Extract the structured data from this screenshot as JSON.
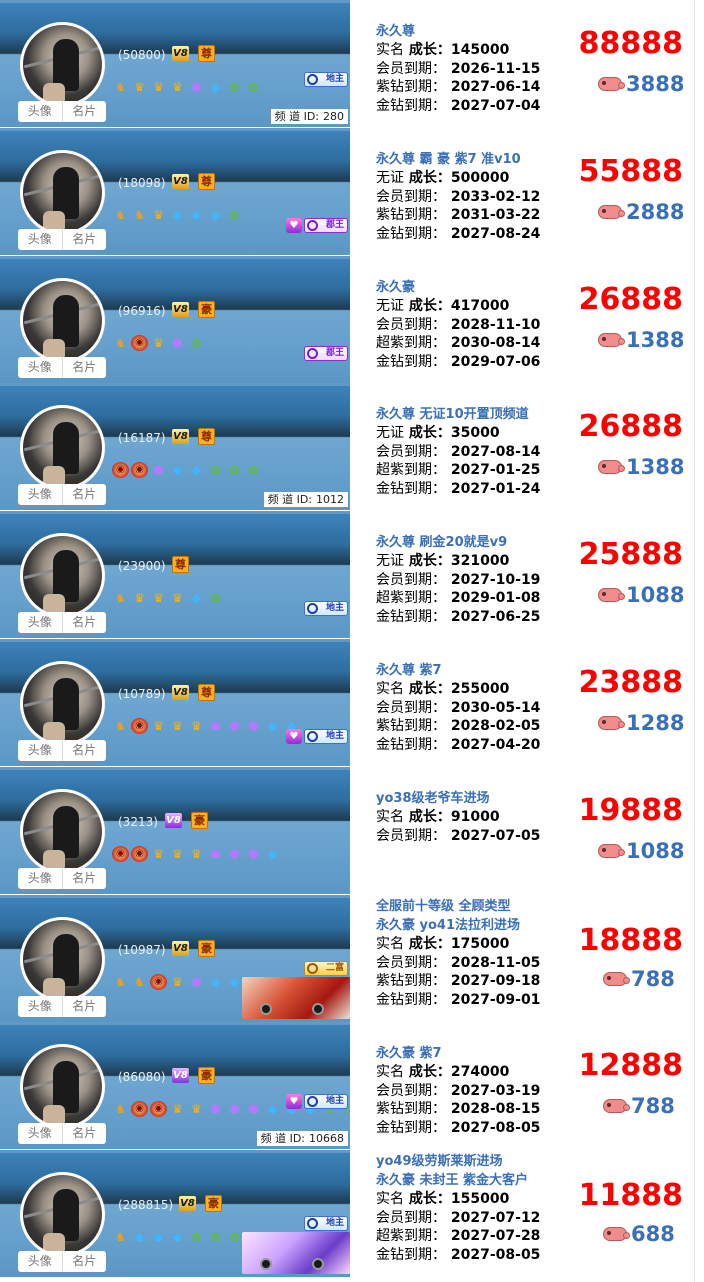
{
  "avatar_tabs": {
    "avatar": "头像",
    "card": "名片"
  },
  "channel_label": "频 道 ID:",
  "cards": [
    {
      "uid": "(50800)",
      "vip": "V8",
      "vip_color": "gold",
      "noble": "尊",
      "icons": [
        "eagle-icon",
        "crown-icon",
        "crown-icon",
        "crown-icon",
        "gem-icon",
        "diamond-icon",
        "leaf-icon",
        "leaf-icon"
      ],
      "lord": "地主",
      "lord_style": "blue",
      "gift": false,
      "channel_id": "280",
      "car": "",
      "headline": [
        "永久尊"
      ],
      "lines": [
        [
          "实名",
          "成长：145000"
        ],
        [
          "会员到期：",
          "2026-11-15"
        ],
        [
          "紫钻到期：",
          "2027-06-14"
        ],
        [
          "金钻到期：",
          "2027-07-04"
        ]
      ],
      "price": "88888",
      "sub": "3888"
    },
    {
      "uid": "(18098)",
      "vip": "V8",
      "vip_color": "gold",
      "noble": "尊",
      "icons": [
        "eagle-icon",
        "eagle-icon",
        "crown-icon",
        "diamond-icon",
        "diamond-icon",
        "diamond-icon",
        "leaf-icon"
      ],
      "lord": "郡王",
      "lord_style": "purple",
      "gift": true,
      "gift_style": "purple",
      "channel_id": "",
      "car": "",
      "headline": [
        "永久尊 霸 豪 紫7 准v10"
      ],
      "lines": [
        [
          "无证",
          "成长：500000"
        ],
        [
          "会员到期：",
          "2033-02-12"
        ],
        [
          "紫钻到期：",
          "2031-03-22"
        ],
        [
          "金钻到期：",
          "2027-08-24"
        ]
      ],
      "price": "55888",
      "sub": "2888"
    },
    {
      "uid": "(96916)",
      "vip": "V8",
      "vip_color": "gold",
      "noble": "豪",
      "icons": [
        "eagle-icon",
        "lion-icon",
        "crown-icon",
        "gem-icon",
        "leaf-icon"
      ],
      "lord": "郡王",
      "lord_style": "purple",
      "gift": false,
      "channel_id": "",
      "car": "",
      "headline": [
        "永久豪"
      ],
      "lines": [
        [
          "无证",
          "成长：417000"
        ],
        [
          "会员到期：",
          "2028-11-10"
        ],
        [
          "超紫到期：",
          "2030-08-14"
        ],
        [
          "金钻到期：",
          "2029-07-06"
        ]
      ],
      "price": "26888",
      "sub": "1388"
    },
    {
      "uid": "(16187)",
      "vip": "V8",
      "vip_color": "gold",
      "noble": "尊",
      "icons": [
        "lion-icon",
        "lion-icon",
        "gem-icon",
        "diamond-icon",
        "diamond-icon",
        "leaf-icon",
        "leaf-icon",
        "leaf-icon"
      ],
      "lord": "",
      "lord_style": "blue",
      "gift": false,
      "channel_id": "1012",
      "car": "",
      "headline": [
        "永久尊 无证10开置顶频道"
      ],
      "lines": [
        [
          "无证",
          "成长：35000"
        ],
        [
          "会员到期：",
          "2027-08-14"
        ],
        [
          "超紫到期：",
          "2027-01-25"
        ],
        [
          "金钻到期：",
          "2027-01-24"
        ]
      ],
      "price": "26888",
      "sub": "1388"
    },
    {
      "uid": "(23900)",
      "vip": "",
      "vip_color": "gold",
      "noble": "尊",
      "icons": [
        "eagle-icon",
        "crown-icon",
        "crown-icon",
        "crown-icon",
        "diamond-icon",
        "leaf-icon"
      ],
      "lord": "地主",
      "lord_style": "blue",
      "gift": false,
      "channel_id": "",
      "car": "",
      "headline": [
        "永久尊  刷金20就是v9"
      ],
      "lines": [
        [
          "无证",
          "成长：321000"
        ],
        [
          "会员到期：",
          "2027-10-19"
        ],
        [
          "超紫到期：",
          "2029-01-08"
        ],
        [
          "金钻到期：",
          "2027-06-25"
        ]
      ],
      "price": "25888",
      "sub": "1088"
    },
    {
      "uid": "(10789)",
      "vip": "V8",
      "vip_color": "gold",
      "noble": "尊",
      "icons": [
        "eagle-icon",
        "lion-icon",
        "crown-icon",
        "crown-icon",
        "crown-icon",
        "gem-icon",
        "gem-icon",
        "gem-icon",
        "diamond-icon",
        "diamond-icon"
      ],
      "lord": "地主",
      "lord_style": "blue",
      "gift": true,
      "gift_style": "purple",
      "channel_id": "",
      "car": "",
      "headline": [
        "永久尊  紫7"
      ],
      "lines": [
        [
          "实名",
          "成长：255000"
        ],
        [
          "会员到期：",
          "2030-05-14"
        ],
        [
          "紫钻到期：",
          "2028-02-05"
        ],
        [
          "金钻到期：",
          "2027-04-20"
        ]
      ],
      "price": "23888",
      "sub": "1288"
    },
    {
      "uid": "(3213)",
      "vip": "V8",
      "vip_color": "purple",
      "noble": "豪",
      "icons": [
        "lion-icon",
        "lion-icon",
        "crown-icon",
        "crown-icon",
        "crown-icon",
        "gem-icon",
        "gem-icon",
        "gem-icon",
        "diamond-icon"
      ],
      "lord": "",
      "lord_style": "blue",
      "gift": false,
      "channel_id": "",
      "car": "",
      "headline": [
        "yo38级老爷车进场"
      ],
      "lines": [
        [
          "实名",
          "成长：91000"
        ],
        [
          "会员到期：",
          "2027-07-05"
        ]
      ],
      "price": "19888",
      "sub": "1088"
    },
    {
      "uid": "(10987)",
      "vip": "V8",
      "vip_color": "gold",
      "noble": "豪",
      "icons": [
        "eagle-icon",
        "eagle-icon",
        "lion-icon",
        "crown-icon",
        "gem-icon",
        "diamond-icon",
        "diamond-icon"
      ],
      "lord": "二富",
      "lord_style": "gold",
      "gift": false,
      "channel_id": "",
      "car": "red",
      "headline": [
        "全服前十等级 全顾类型",
        "永久豪 yo41法拉利进场"
      ],
      "lines": [
        [
          "实名",
          "成长：175000"
        ],
        [
          "会员到期：",
          "2028-11-05"
        ],
        [
          "紫钻到期：",
          "2027-09-18"
        ],
        [
          "金钻到期：",
          "2027-09-01"
        ]
      ],
      "price": "18888",
      "sub": "788"
    },
    {
      "uid": "(86080)",
      "vip": "V8",
      "vip_color": "purple",
      "noble": "豪",
      "icons": [
        "eagle-icon",
        "lion-icon",
        "lion-icon",
        "crown-icon",
        "crown-icon",
        "gem-icon",
        "gem-icon",
        "gem-icon",
        "diamond-icon",
        "diamond-icon",
        "diamond-icon",
        "leaf-icon",
        "leaf-icon"
      ],
      "lord": "地主",
      "lord_style": "blue",
      "gift": true,
      "gift_style": "purple",
      "channel_id": "10668",
      "car": "",
      "headline": [
        "永久豪  紫7"
      ],
      "lines": [
        [
          "实名",
          "成长：274000"
        ],
        [
          "会员到期：",
          "2027-03-19"
        ],
        [
          "紫钻到期：",
          "2028-08-15"
        ],
        [
          "金钻到期：",
          "2027-08-05"
        ]
      ],
      "price": "12888",
      "sub": "788"
    },
    {
      "uid": "(288815)",
      "vip": "V8",
      "vip_color": "gold",
      "noble": "豪",
      "icons": [
        "eagle-icon",
        "diamond-icon",
        "diamond-icon",
        "diamond-icon",
        "leaf-icon",
        "leaf-icon",
        "leaf-icon"
      ],
      "lord": "地主",
      "lord_style": "blue",
      "gift": false,
      "channel_id": "",
      "car": "pink",
      "headline": [
        "yo49级劳斯莱斯进场",
        "永久豪  未封王 紫金大客户"
      ],
      "lines": [
        [
          "实名",
          "成长：155000"
        ],
        [
          "会员到期：",
          "2027-07-12"
        ],
        [
          "超紫到期：",
          "2027-07-28"
        ],
        [
          "金钻到期：",
          "2027-08-05"
        ]
      ],
      "price": "11888",
      "sub": "688"
    }
  ]
}
